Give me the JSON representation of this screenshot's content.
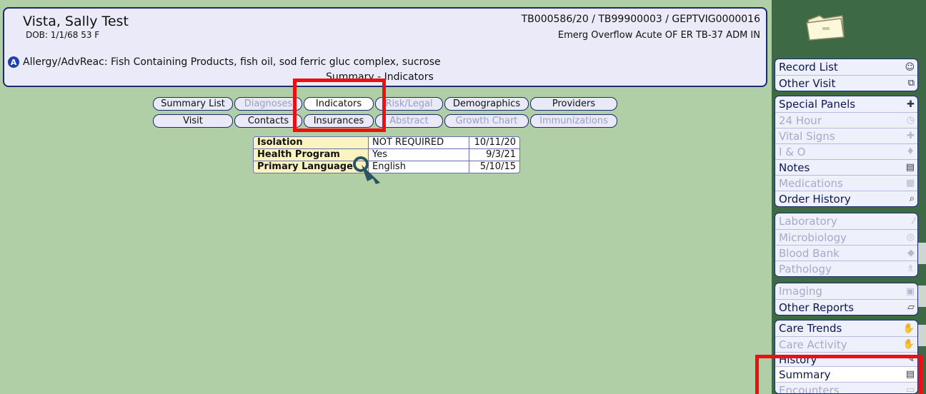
{
  "patient": {
    "name": "Vista, Sally Test",
    "dob": "DOB: 1/1/68 53 F",
    "ids": "TB000586/20 / TB99900003 / GEPTVIG0000016",
    "location": "Emerg Overflow Acute OF ER TB-37  ADM IN",
    "allergy_icon": "A",
    "allergy": "Allergy/AdvReac: Fish Containing Products, fish oil, sod ferric gluc complex, sucrose"
  },
  "page_title": "Summary - Indicators",
  "tabs": {
    "summary_list": "Summary List",
    "diagnoses": "Diagnoses",
    "indicators": "Indicators",
    "risk_legal": "Risk/Legal",
    "demographics": "Demographics",
    "providers": "Providers",
    "visit": "Visit",
    "contacts": "Contacts",
    "insurances": "Insurances",
    "abstract": "Abstract",
    "growth_chart": "Growth Chart",
    "immunizations": "Immunizations"
  },
  "indicators": [
    {
      "label": "Isolation",
      "value": "NOT REQUIRED",
      "date": "10/11/20"
    },
    {
      "label": "Health Program",
      "value": "Yes",
      "date": "9/3/21"
    },
    {
      "label": "Primary Language",
      "value": "English",
      "date": "5/10/15"
    }
  ],
  "sidebar": {
    "record_list": "Record List",
    "other_visit": "Other Visit",
    "special_panels": "Special Panels",
    "hour24": "24 Hour",
    "vital_signs": "Vital Signs",
    "io": "I & O",
    "notes": "Notes",
    "medications": "Medications",
    "order_history": "Order History",
    "laboratory": "Laboratory",
    "microbiology": "Microbiology",
    "blood_bank": "Blood Bank",
    "pathology": "Pathology",
    "imaging": "Imaging",
    "other_reports": "Other Reports",
    "care_trends": "Care Trends",
    "care_activity": "Care Activity",
    "history": "History",
    "summary": "Summary",
    "encounters": "Encounters"
  },
  "colors": {
    "background_green": "#b0cfa6",
    "sidebar_green": "#3d6a45",
    "highlight_red": "#ee1010",
    "navy": "#1a2b6e"
  }
}
